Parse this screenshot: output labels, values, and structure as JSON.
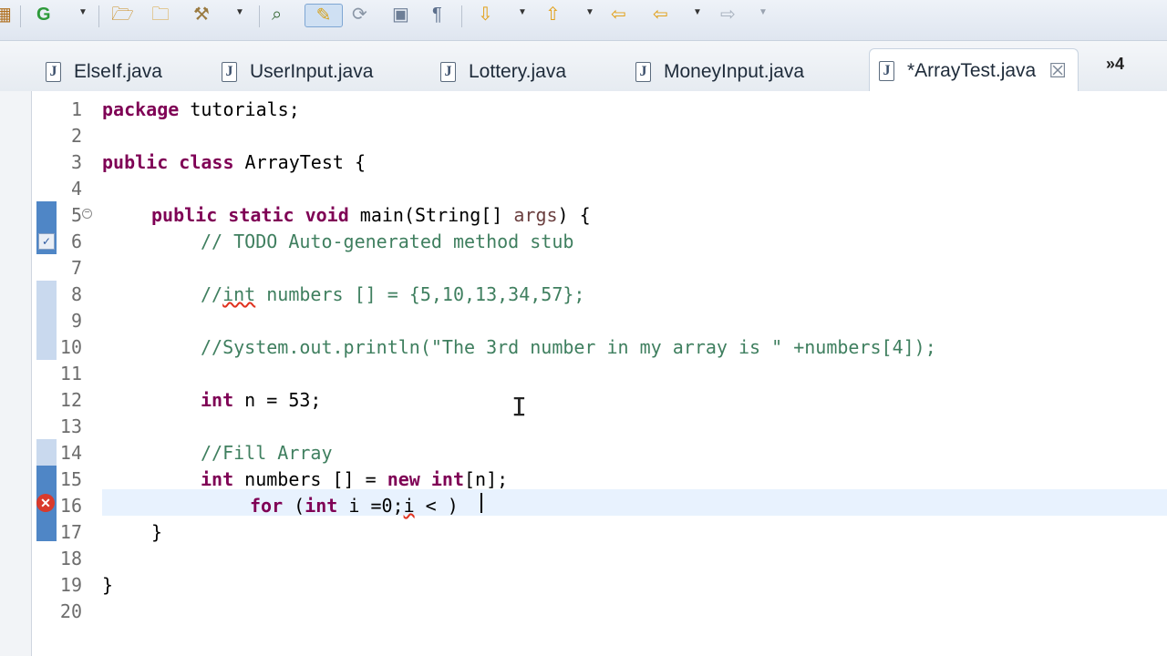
{
  "toolbar": {
    "icons": [
      "grid-icon",
      "new-wizard-icon",
      "open-project-icon",
      "open-folder-icon",
      "run-tool-icon",
      "search-icon",
      "mark-occurrences-icon",
      "format-icon",
      "block-select-icon",
      "show-whitespace-icon",
      "next-annotation-icon",
      "previous-annotation-icon",
      "last-edit-icon",
      "back-icon",
      "forward-icon"
    ]
  },
  "tabs": [
    {
      "label": "ElseIf.java"
    },
    {
      "label": "UserInput.java"
    },
    {
      "label": "Lottery.java"
    },
    {
      "label": "MoneyInput.java"
    },
    {
      "label": "*ArrayTest.java",
      "active": true
    }
  ],
  "overflow_count": "»4",
  "editor": {
    "line_numbers": [
      "1",
      "2",
      "3",
      "4",
      "5",
      "6",
      "7",
      "8",
      "9",
      "10",
      "11",
      "12",
      "13",
      "14",
      "15",
      "16",
      "17",
      "18",
      "19",
      "20"
    ],
    "lines": {
      "l1_kw": "package",
      "l1_rest": " tutorials;",
      "l3_kw": "public class",
      "l3_rest": " ArrayTest {",
      "l5_kw": "public static void",
      "l5_mid": " main(String[] ",
      "l5_param": "args",
      "l5_end": ") {",
      "l6_comment": "// TODO Auto-generated method stub",
      "l8_a": "//",
      "l8_b": "int",
      "l8_c": " numbers [] = {5,10,13,34,57};",
      "l10_comment": "//System.out.println(\"The 3rd number in my array is \" +numbers[4]);",
      "l12_kw": "int",
      "l12_rest": " n = 53;",
      "l14_comment": "//Fill Array",
      "l15_kw": "int",
      "l15_mid": " numbers [] = ",
      "l15_new": "new",
      "l15_int": "int",
      "l15_end": "[n];",
      "l16_for": "for",
      "l16_a": " (",
      "l16_int": "int",
      "l16_b": " i =0;",
      "l16_i": "i",
      "l16_c": " < ",
      "l16_d": ")",
      "l17": "}",
      "l19": "}"
    }
  },
  "colors": {
    "keyword": "#7f0055",
    "comment": "#3f7f5f",
    "current_line": "#e8f2fe",
    "error": "#d93a2c"
  }
}
